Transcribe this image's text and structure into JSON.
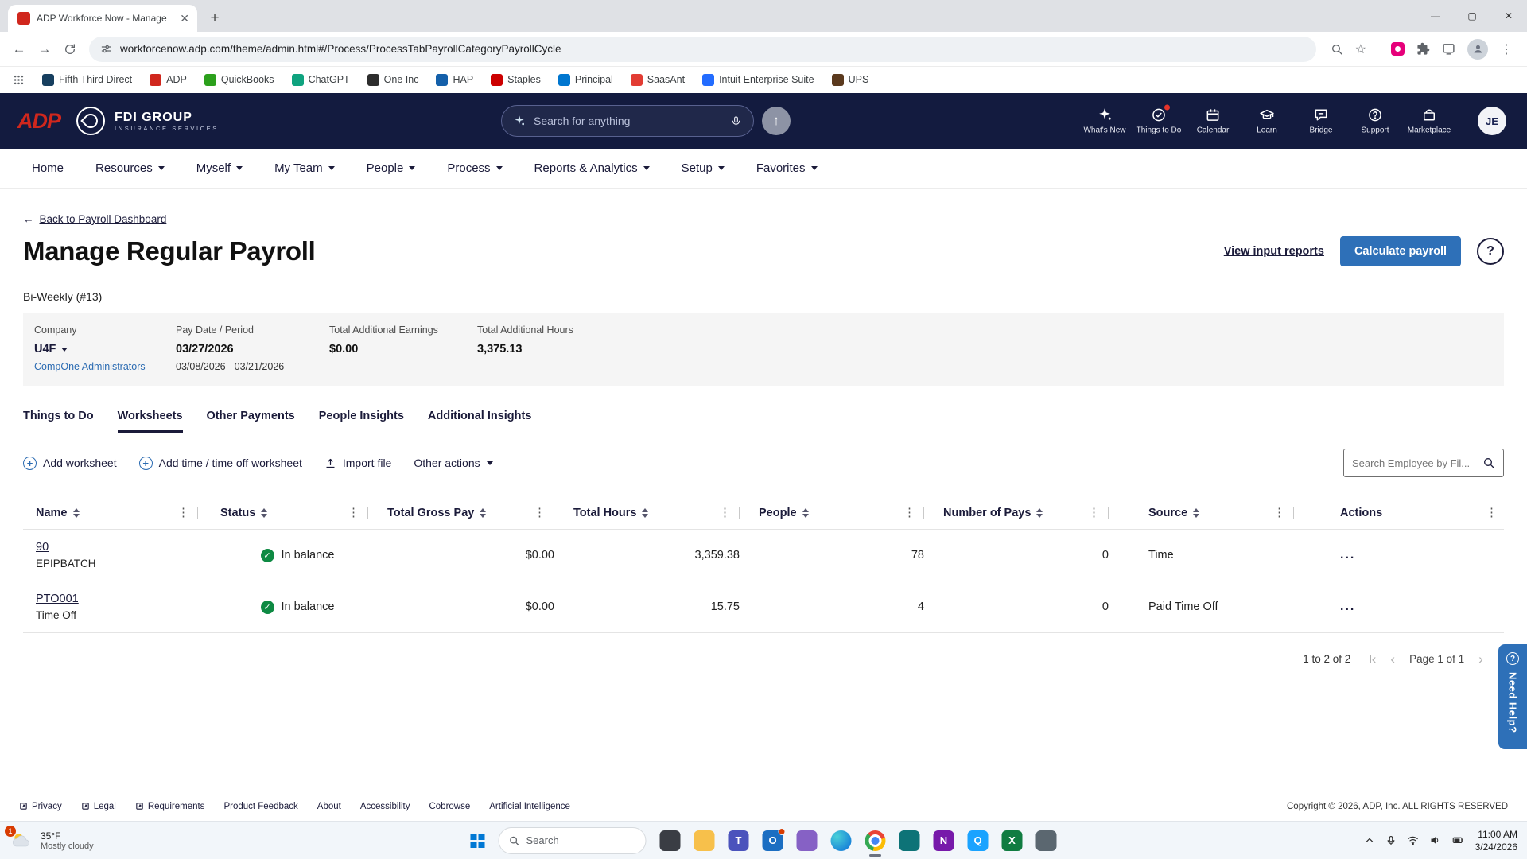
{
  "theme": {
    "header_bg": "#131b3f",
    "accent_blue": "#2e70b8",
    "link_navy": "#1b1b3a",
    "success_green": "#0e8a43",
    "adp_red": "#d0271d"
  },
  "browser": {
    "tab_title": "ADP Workforce Now - Manage",
    "url": "workforcenow.adp.com/theme/admin.html#/Process/ProcessTabPayrollCategoryPayrollCycle",
    "bookmarks": [
      {
        "label": "Fifth Third Direct",
        "color": "#173f5f"
      },
      {
        "label": "ADP",
        "color": "#d0271d"
      },
      {
        "label": "QuickBooks",
        "color": "#2ca01c"
      },
      {
        "label": "ChatGPT",
        "color": "#0fa37f"
      },
      {
        "label": "One Inc",
        "color": "#2d2d2d"
      },
      {
        "label": "HAP",
        "color": "#1460aa"
      },
      {
        "label": "Staples",
        "color": "#cc0000"
      },
      {
        "label": "Principal",
        "color": "#0076cf"
      },
      {
        "label": "SaasAnt",
        "color": "#e23c33"
      },
      {
        "label": "Intuit Enterprise Suite",
        "color": "#236cff"
      },
      {
        "label": "UPS",
        "color": "#5b3a1e"
      }
    ]
  },
  "adp_header": {
    "logo": "ADP",
    "company_name": "FDI GROUP",
    "company_tagline": "INSURANCE SERVICES",
    "search_placeholder": "Search for anything",
    "icons": [
      {
        "name": "whats-new-icon",
        "label": "What's New"
      },
      {
        "name": "things-to-do-icon",
        "label": "Things to Do"
      },
      {
        "name": "calendar-icon",
        "label": "Calendar"
      },
      {
        "name": "learn-icon",
        "label": "Learn"
      },
      {
        "name": "bridge-icon",
        "label": "Bridge"
      },
      {
        "name": "support-icon",
        "label": "Support"
      },
      {
        "name": "marketplace-icon",
        "label": "Marketplace"
      }
    ],
    "avatar_initials": "JE"
  },
  "nav": [
    "Home",
    "Resources",
    "Myself",
    "My Team",
    "People",
    "Process",
    "Reports & Analytics",
    "Setup",
    "Favorites"
  ],
  "page": {
    "back_link": "Back to Payroll Dashboard",
    "title": "Manage Regular Payroll",
    "view_reports_link": "View input reports",
    "calculate_button": "Calculate payroll",
    "cycle_label": "Bi-Weekly (#13)",
    "summary": {
      "company_label": "Company",
      "company_value": "U4F",
      "company_link": "CompOne Administrators",
      "pay_label": "Pay Date / Period",
      "pay_date": "03/27/2026",
      "pay_period": "03/08/2026 - 03/21/2026",
      "earnings_label": "Total Additional Earnings",
      "earnings_value": "$0.00",
      "hours_label": "Total Additional Hours",
      "hours_value": "3,375.13"
    },
    "tabs": [
      "Things to Do",
      "Worksheets",
      "Other Payments",
      "People Insights",
      "Additional Insights"
    ],
    "active_tab": "Worksheets",
    "toolbar": {
      "add_worksheet": "Add worksheet",
      "add_time": "Add time / time off worksheet",
      "import_file": "Import file",
      "other_actions": "Other actions",
      "search_placeholder": "Search Employee by Fil..."
    },
    "table": {
      "columns": [
        "Name",
        "Status",
        "Total Gross Pay",
        "Total Hours",
        "People",
        "Number of Pays",
        "Source",
        "Actions"
      ],
      "rows": [
        {
          "name": "90",
          "sub": "EPIPBATCH",
          "status": "In balance",
          "gross": "$0.00",
          "hours": "3,359.38",
          "people": "78",
          "pays": "0",
          "source": "Time"
        },
        {
          "name": "PTO001",
          "sub": "Time Off",
          "status": "In balance",
          "gross": "$0.00",
          "hours": "15.75",
          "people": "4",
          "pays": "0",
          "source": "Paid Time Off"
        }
      ]
    },
    "pagination": {
      "summary": "1 to 2 of 2",
      "page": "Page 1 of 1"
    }
  },
  "footer": {
    "links": [
      "Privacy",
      "Legal",
      "Requirements",
      "Product Feedback",
      "About",
      "Accessibility",
      "Cobrowse",
      "Artificial Intelligence"
    ],
    "copyright": "Copyright © 2026, ADP, Inc. ALL RIGHTS RESERVED"
  },
  "help_tab": "Need Help?",
  "taskbar": {
    "weather_temp": "35°F",
    "weather_desc": "Mostly cloudy",
    "weather_badge": "1",
    "search_placeholder": "Search",
    "time": "11:00 AM",
    "date": "3/24/2026"
  }
}
